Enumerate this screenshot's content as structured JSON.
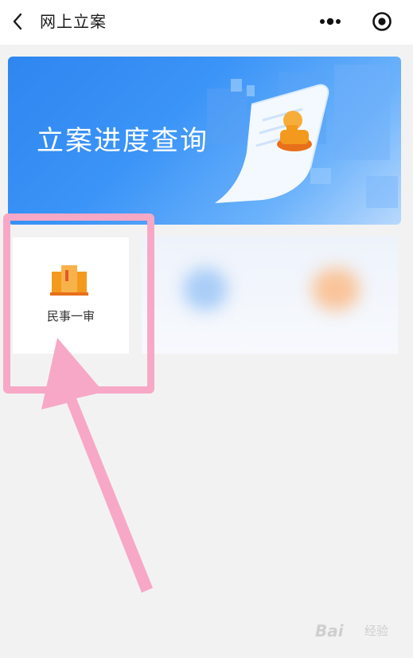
{
  "navbar": {
    "title": "网上立案",
    "back_icon": "chevron-left-icon",
    "more_icon": "more-dots-icon",
    "close_icon": "target-circle-icon"
  },
  "banner": {
    "title": "立案进度查询",
    "background_color": "#3b94f7"
  },
  "services": [
    {
      "label": "民事一审",
      "icon": "courthouse-icon",
      "icon_color": "#f39a1e"
    }
  ],
  "annotation": {
    "highlight_color": "#f7a8c6"
  },
  "watermark": {
    "brand": "Bai",
    "suffix": "经验"
  }
}
